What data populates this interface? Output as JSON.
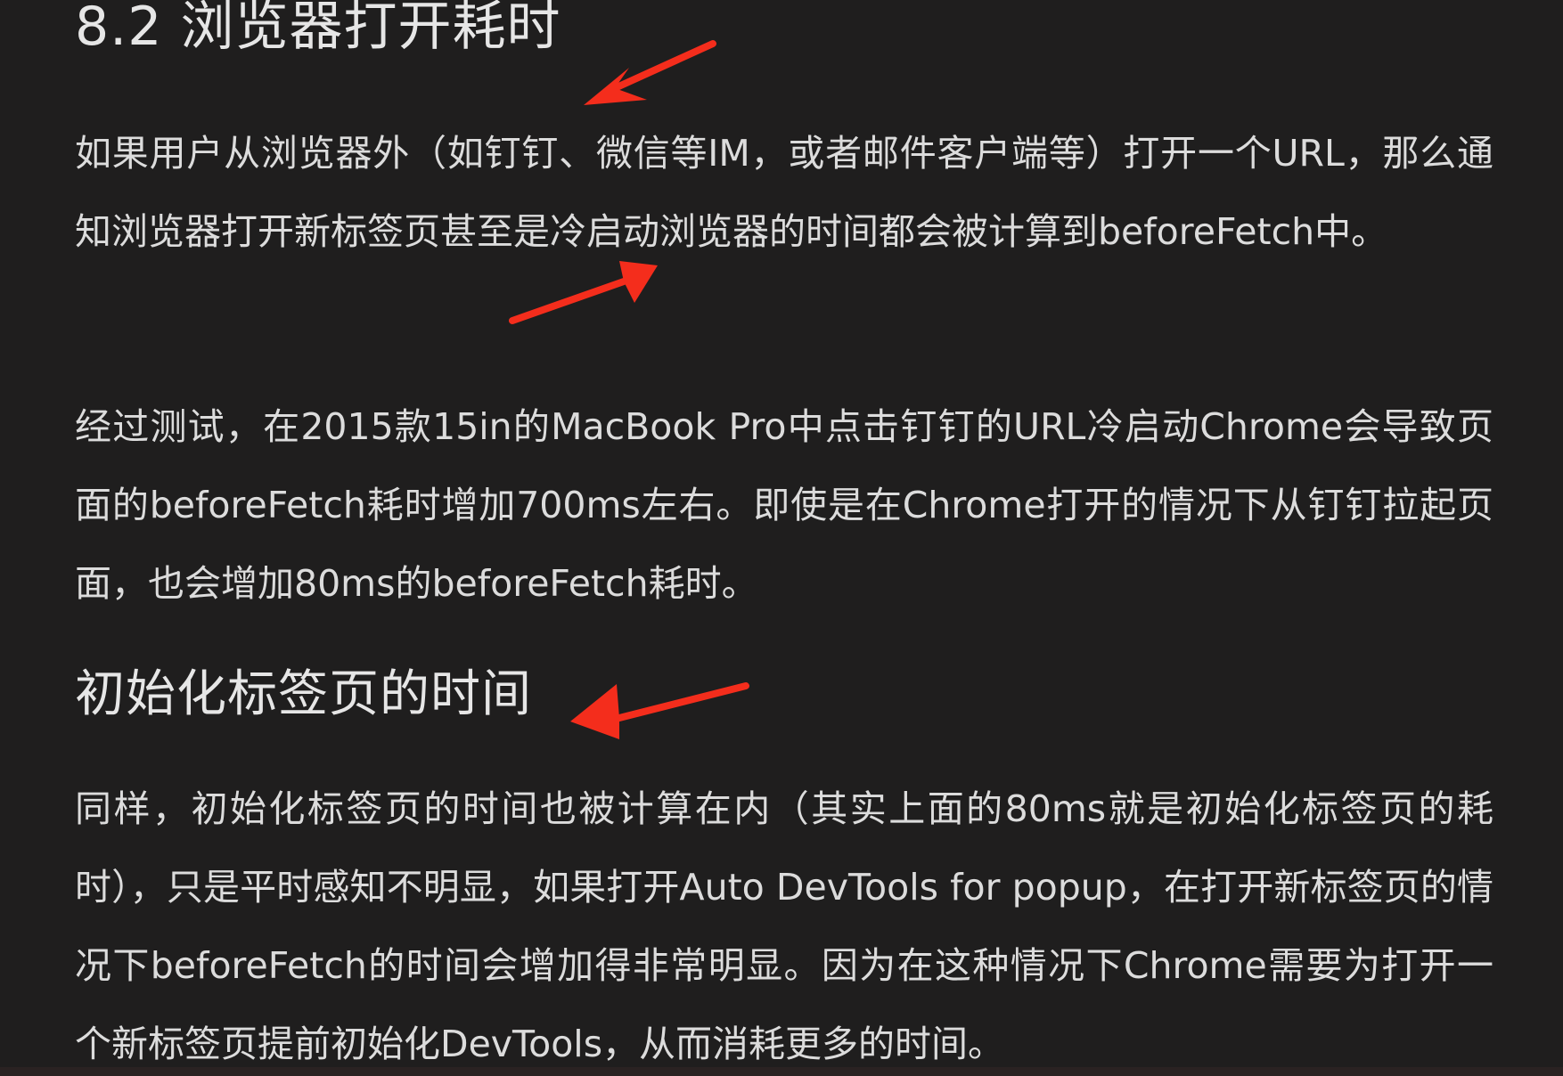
{
  "section": {
    "heading": "8.2 浏览器打开耗时"
  },
  "paragraphs": [
    "如果用户从浏览器外（如钉钉、微信等IM，或者邮件客户端等）打开一个URL，那么通知浏览器打开新标签页甚至是冷启动浏览器的时间都会被计算到beforeFetch中。",
    "经过测试，在2015款15in的MacBook Pro中点击钉钉的URL冷启动Chrome会导致页面的beforeFetch耗时增加700ms左右。即使是在Chrome打开的情况下从钉钉拉起页面，也会增加80ms的beforeFetch耗时。",
    "同样，初始化标签页的时间也被计算在内（其实上面的80ms就是初始化标签页的耗时），只是平时感知不明显，如果打开Auto DevTools for popup，在打开新标签页的情况下beforeFetch的时间会增加得非常明显。因为在这种情况下Chrome需要为打开一个新标签页提前初始化DevTools，从而消耗更多的时间。"
  ],
  "subsection": {
    "heading": "初始化标签页的时间"
  },
  "colors": {
    "background": "#1f1e1e",
    "text": "#dcdcdc",
    "annotation_arrow": "#f42d1c"
  }
}
